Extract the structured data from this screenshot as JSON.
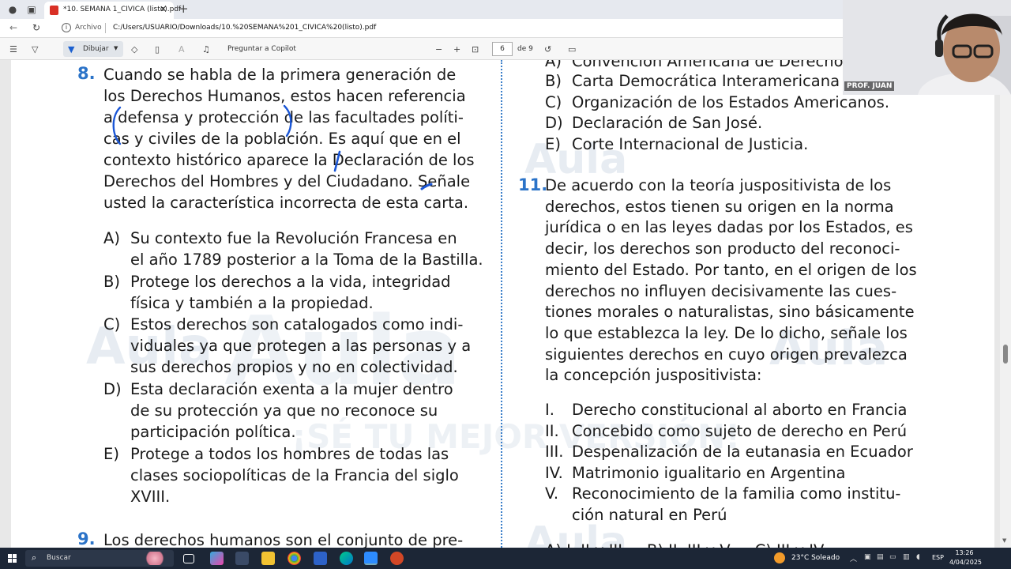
{
  "browser": {
    "tab_title": "*10. SEMANA 1_CIVICA (listo).pdf",
    "address_label": "Archivo",
    "url": "C:/Users/USUARIO/Downloads/10.%20SEMANA%201_CIVICA%20(listo).pdf"
  },
  "pdf_toolbar": {
    "draw_label": "Dibujar",
    "copilot_label": "Preguntar a Copilot",
    "page_current": "6",
    "page_total": "de 9"
  },
  "watermark": {
    "brand": "Aula",
    "slogan": "¡SÉ TU MEJOR VERSIÓN!"
  },
  "q8": {
    "number": "8.",
    "stem_lines": [
      "Cuando se habla de la primera generación de",
      "los Derechos Humanos, estos hacen referencia",
      "a defensa y protección de las facultades políti-",
      "cas y civiles de la población. Es aquí que en el",
      "contexto histórico aparece la Declaración de los",
      "Derechos del Hombres y del Ciudadano. Señale",
      "usted la característica incorrecta de esta carta."
    ],
    "options": [
      {
        "letter": "A)",
        "lines": [
          "Su contexto fue la Revolución Francesa en",
          "el año 1789 posterior a la Toma de la Bastilla."
        ]
      },
      {
        "letter": "B)",
        "lines": [
          "Protege los derechos a la vida, integridad",
          "física y también a la propiedad."
        ]
      },
      {
        "letter": "C)",
        "lines": [
          "Estos derechos son catalogados como indi-",
          "viduales ya que protegen a las personas y a",
          "sus derechos propios y no en colectividad."
        ]
      },
      {
        "letter": "D)",
        "lines": [
          "Esta declaración exenta a la mujer dentro",
          "de su protección ya que no reconoce su",
          "participación política."
        ]
      },
      {
        "letter": "E)",
        "lines": [
          "Protege a todos los hombres de todas las",
          "clases sociopolíticas de la Francia del siglo",
          "XVIII."
        ]
      }
    ]
  },
  "q9": {
    "number": "9.",
    "stem_first_line": "Los derechos humanos son el conjunto de pre-"
  },
  "q10_options": [
    {
      "letter": "A)",
      "text": "Convención Americana de Derechos"
    },
    {
      "letter": "B)",
      "text": "Carta Democrática Interamericana"
    },
    {
      "letter": "C)",
      "text": "Organización de los Estados Americanos."
    },
    {
      "letter": "D)",
      "text": "Declaración de San José."
    },
    {
      "letter": "E)",
      "text": "Corte Internacional de Justicia."
    }
  ],
  "q11": {
    "number": "11.",
    "stem_lines": [
      "De acuerdo con la teoría juspositivista de los",
      "derechos, estos tienen su origen en la norma",
      "jurídica o en las leyes dadas por los Estados, es",
      "decir, los derechos son producto del reconoci-",
      "miento del Estado. Por tanto, en el origen de los",
      "derechos no influyen decisivamente las cues-",
      "tiones morales o naturalistas, sino básicamente",
      "lo que establezca la ley. De lo dicho, señale los",
      "siguientes derechos en cuyo origen prevalezca",
      "la concepción juspositivista:"
    ],
    "items": [
      {
        "numeral": "I.",
        "lines": [
          "Derecho constitucional al aborto en Francia"
        ]
      },
      {
        "numeral": "II.",
        "lines": [
          "Concebido como sujeto de derecho en Perú"
        ]
      },
      {
        "numeral": "III.",
        "lines": [
          "Despenalización de la eutanasia en Ecuador"
        ]
      },
      {
        "numeral": "IV.",
        "lines": [
          "Matrimonio igualitario en Argentina"
        ]
      },
      {
        "numeral": "V.",
        "lines": [
          "Reconocimiento de la familia como institu-",
          "ción natural en Perú"
        ]
      }
    ],
    "answer_row_partial": "A) I, II y III     B) II, III y V     C) III y IV"
  },
  "webcam": {
    "label": "PROF. JUAN"
  },
  "taskbar": {
    "search_label": "Buscar",
    "weather": "23°C  Soleado",
    "language": "ESP",
    "time": "13:26",
    "date": "4/04/2025"
  },
  "colors": {
    "question_number": "#2b73c8",
    "ink": "#1a56d6",
    "divider": "#3a7ec9",
    "taskbar": "#1c2636"
  },
  "icons": [
    "tab-actions-icon",
    "pdf-file-icon",
    "close-icon",
    "new-tab-icon",
    "back-icon",
    "refresh-icon",
    "info-icon",
    "contents-icon",
    "highlight-icon",
    "pen-icon",
    "eraser-icon",
    "text-icon",
    "read-aloud-icon",
    "zoom-out-icon",
    "zoom-in-icon",
    "fit-page-icon",
    "rotate-icon",
    "page-view-icon",
    "windows-start-icon",
    "search-icon",
    "weather-sun-icon"
  ]
}
